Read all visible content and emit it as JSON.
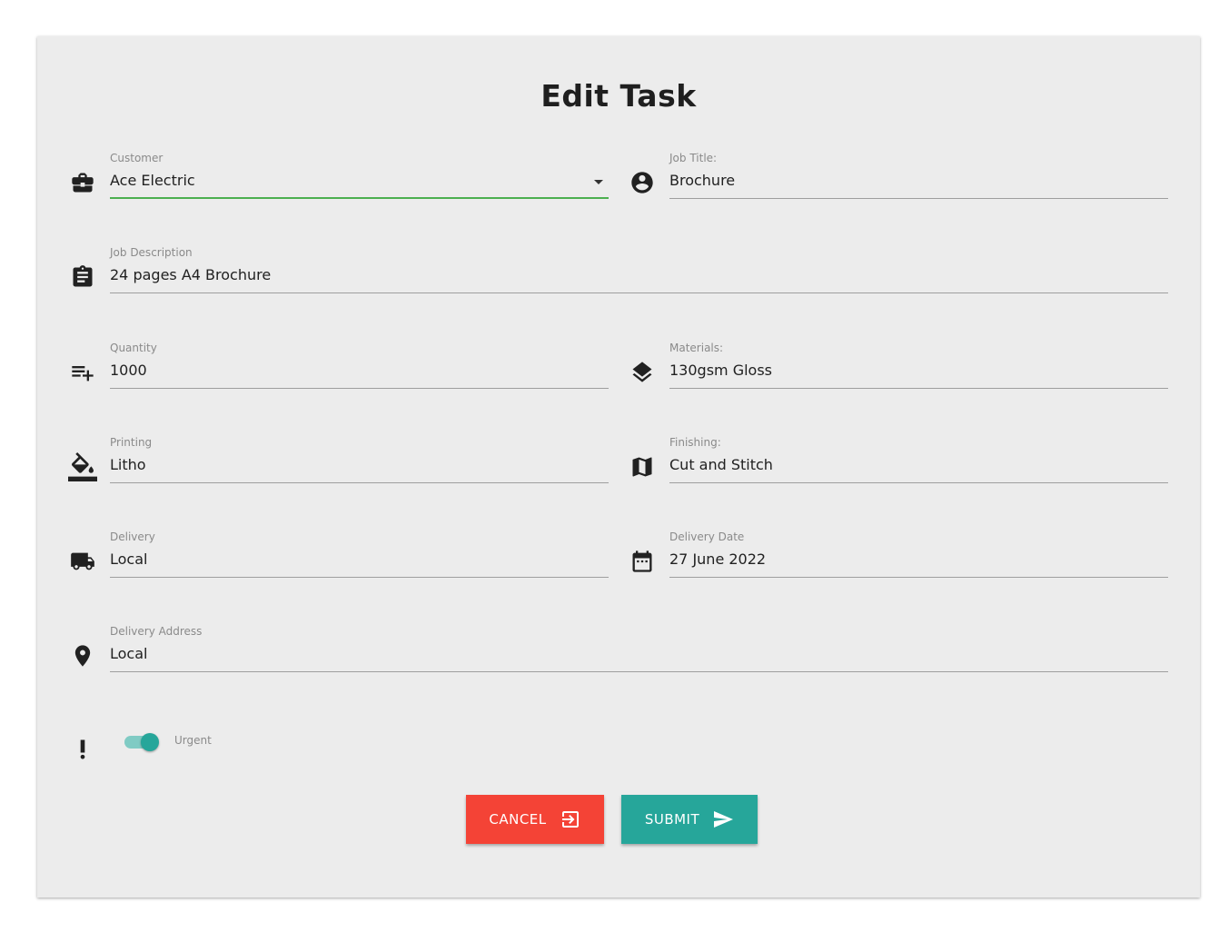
{
  "page": {
    "title": "Edit Task"
  },
  "form": {
    "customer": {
      "label": "Customer",
      "value": "Ace Electric",
      "icon": "briefcase-icon"
    },
    "job_title": {
      "label": "Job Title:",
      "value": "Brochure",
      "icon": "account-circle-icon"
    },
    "job_description": {
      "label": "Job Description",
      "value": "24 pages A4 Brochure",
      "icon": "clipboard-icon"
    },
    "quantity": {
      "label": "Quantity",
      "value": "1000",
      "icon": "playlist-add-icon"
    },
    "materials": {
      "label": "Materials:",
      "value": "130gsm Gloss",
      "icon": "layers-icon"
    },
    "printing": {
      "label": "Printing",
      "value": "Litho",
      "icon": "format-color-fill-icon"
    },
    "finishing": {
      "label": "Finishing:",
      "value": "Cut and Stitch",
      "icon": "map-icon"
    },
    "delivery": {
      "label": "Delivery",
      "value": "Local",
      "icon": "truck-icon"
    },
    "delivery_date": {
      "label": "Delivery Date",
      "value": "27 June 2022",
      "icon": "calendar-icon"
    },
    "delivery_address": {
      "label": "Delivery Address",
      "value": "Local",
      "icon": "location-pin-icon"
    },
    "urgent": {
      "label": "Urgent",
      "checked": true,
      "icon": "priority-high-icon"
    }
  },
  "buttons": {
    "cancel": {
      "label": "CANCEL",
      "icon": "exit-to-app-icon",
      "color": "#f44336"
    },
    "submit": {
      "label": "SUBMIT",
      "icon": "send-icon",
      "color": "#26a69a"
    }
  },
  "colors": {
    "focus_line": "#4caf50",
    "toggle_on": "#26a69a",
    "card_bg": "#ececec"
  }
}
